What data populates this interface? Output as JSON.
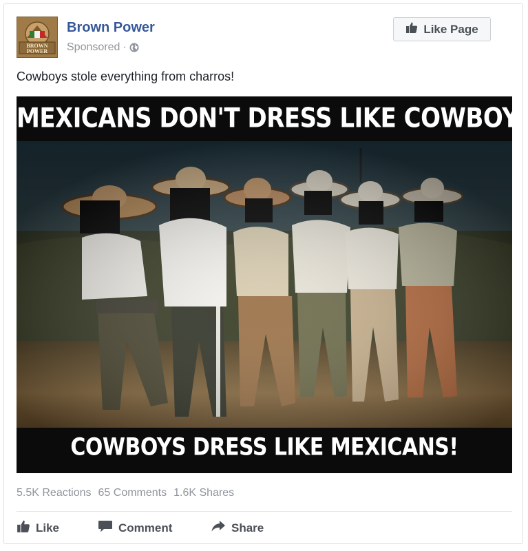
{
  "post": {
    "page_name": "Brown Power",
    "sponsored": "Sponsored",
    "separator": "·",
    "like_page_label": "Like Page",
    "text": "Cowboys stole everything from charros!",
    "avatar_text": "BROWN POWER"
  },
  "meme": {
    "top_caption": "MEXICANS DON'T DRESS LIKE COWBOYS",
    "bottom_caption": "COWBOYS DRESS LIKE MEXICANS!"
  },
  "stats": {
    "reactions": "5.5K Reactions",
    "comments": "65 Comments",
    "shares": "1.6K Shares"
  },
  "actions": {
    "like": "Like",
    "comment": "Comment",
    "share": "Share"
  },
  "icons": [
    "globe-icon",
    "thumbs-up-icon",
    "comment-icon",
    "share-arrow-icon"
  ],
  "colors": {
    "link_blue": "#365899",
    "muted_gray": "#90949c",
    "action_gray": "#4b4f56"
  }
}
